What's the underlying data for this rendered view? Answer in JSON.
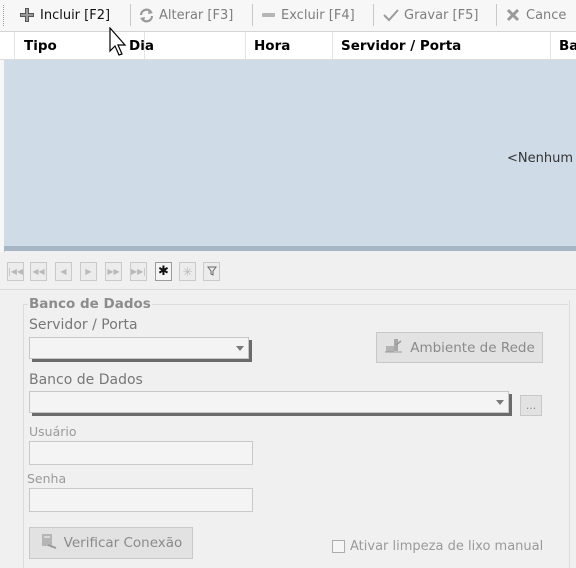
{
  "toolbar": {
    "incluir": "Incluir [F2]",
    "alterar": "Alterar [F3]",
    "excluir": "Excluir [F4]",
    "gravar": "Gravar [F5]",
    "cancelar": "Cance"
  },
  "grid": {
    "columns": [
      "Tipo",
      "Dia",
      "Hora",
      "Servidor / Porta",
      "Ba"
    ],
    "empty_text": "<Nenhum"
  },
  "navigator": {
    "buttons": [
      "first-icon",
      "prior-page-icon",
      "prior-icon",
      "next-icon",
      "next-page-icon",
      "last-icon",
      "asterisk-icon",
      "asterisk-disabled-icon",
      "filter-icon"
    ]
  },
  "form": {
    "group_title": "Banco de Dados",
    "servidor_label": "Servidor / Porta",
    "servidor_value": "",
    "ambiente_button": "Ambiente de Rede",
    "banco_label": "Banco de Dados",
    "banco_value": "",
    "browse_button": "...",
    "usuario_label": "Usuário",
    "usuario_value": "",
    "senha_label": "Senha",
    "senha_value": "",
    "verificar_button": "Verificar Conexão",
    "limpeza_label": "Ativar limpeza de lixo manual"
  },
  "colors": {
    "grid_background": "#cfdbe6",
    "grid_bottom_bar": "#a7b6c4",
    "disabled_text": "#8a8a8a"
  }
}
